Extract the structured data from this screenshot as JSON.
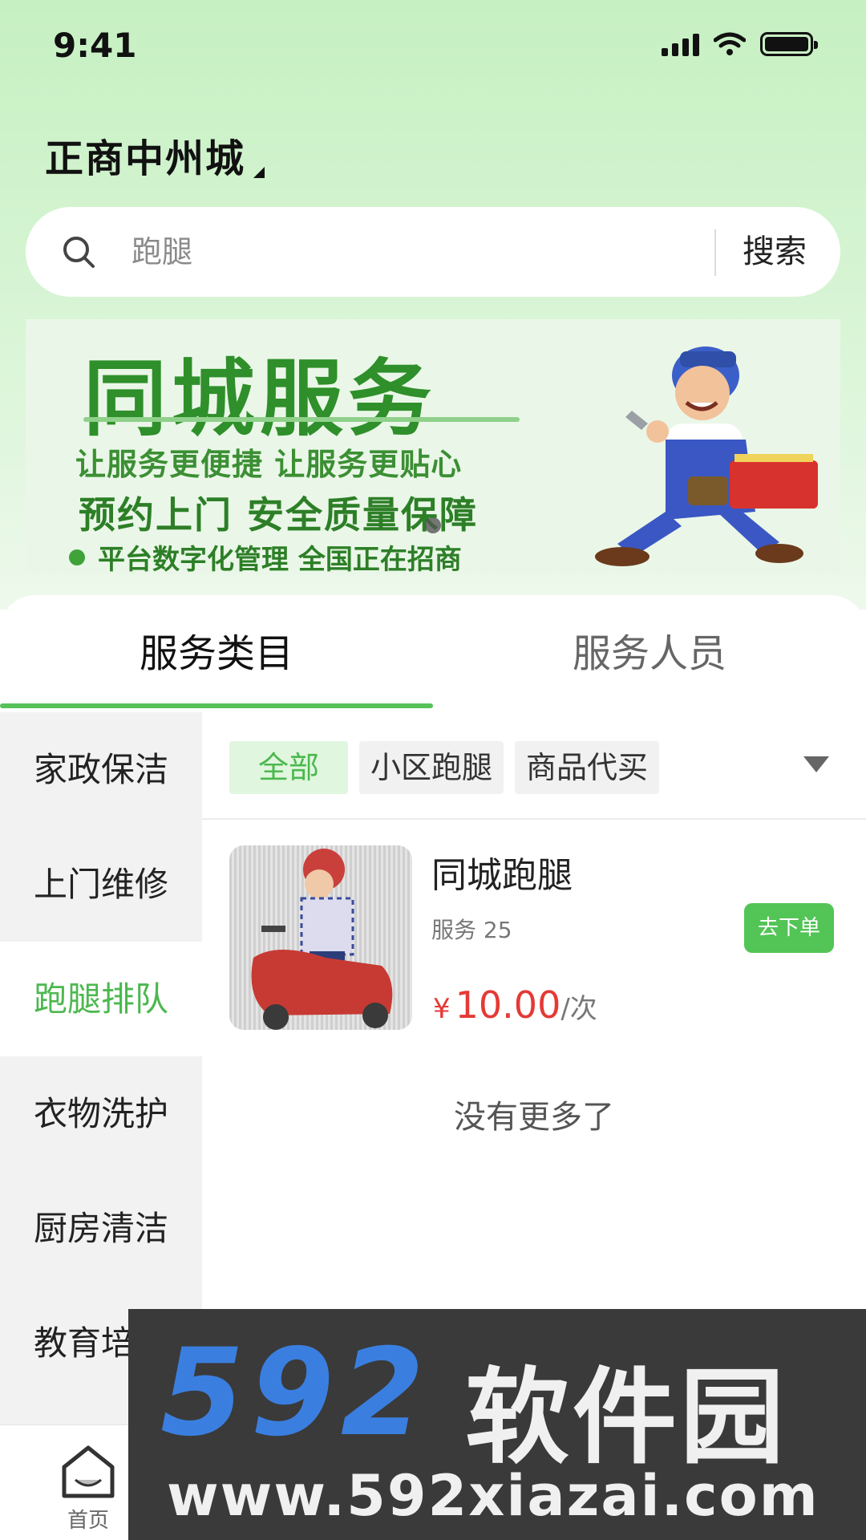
{
  "status_bar": {
    "time": "9:41"
  },
  "location": {
    "name": "正商中州城"
  },
  "search": {
    "placeholder": "跑腿",
    "button_label": "搜索"
  },
  "banner": {
    "title": "同城服务",
    "line1": "让服务更便捷 让服务更贴心",
    "line2": "预约上门 安全质量保障",
    "line3": "平台数字化管理 全国正在招商"
  },
  "tabs": [
    {
      "label": "服务类目",
      "active": true
    },
    {
      "label": "服务人员",
      "active": false
    }
  ],
  "sidebar": {
    "items": [
      {
        "label": "家政保洁"
      },
      {
        "label": "上门维修"
      },
      {
        "label": "跑腿排队",
        "active": true
      },
      {
        "label": "衣物洗护"
      },
      {
        "label": "厨房清洁"
      },
      {
        "label": "教育培"
      }
    ]
  },
  "filters": [
    {
      "label": "全部",
      "active": true
    },
    {
      "label": "小区跑腿"
    },
    {
      "label": "商品代买"
    }
  ],
  "services": [
    {
      "name": "同城跑腿",
      "count_text": "服务 25",
      "price_symbol": "¥",
      "price": "10.00",
      "unit": "/次",
      "order_button": "去下单"
    }
  ],
  "list_end_text": "没有更多了",
  "bottom_nav": {
    "home_label": "首页"
  },
  "watermark": {
    "brand": "592",
    "brand_cn": "软件园",
    "url": "www.592xiazai.com"
  },
  "colors": {
    "accent": "#4cb84f",
    "price": "#e53935",
    "banner_green": "#2f8f2a"
  }
}
